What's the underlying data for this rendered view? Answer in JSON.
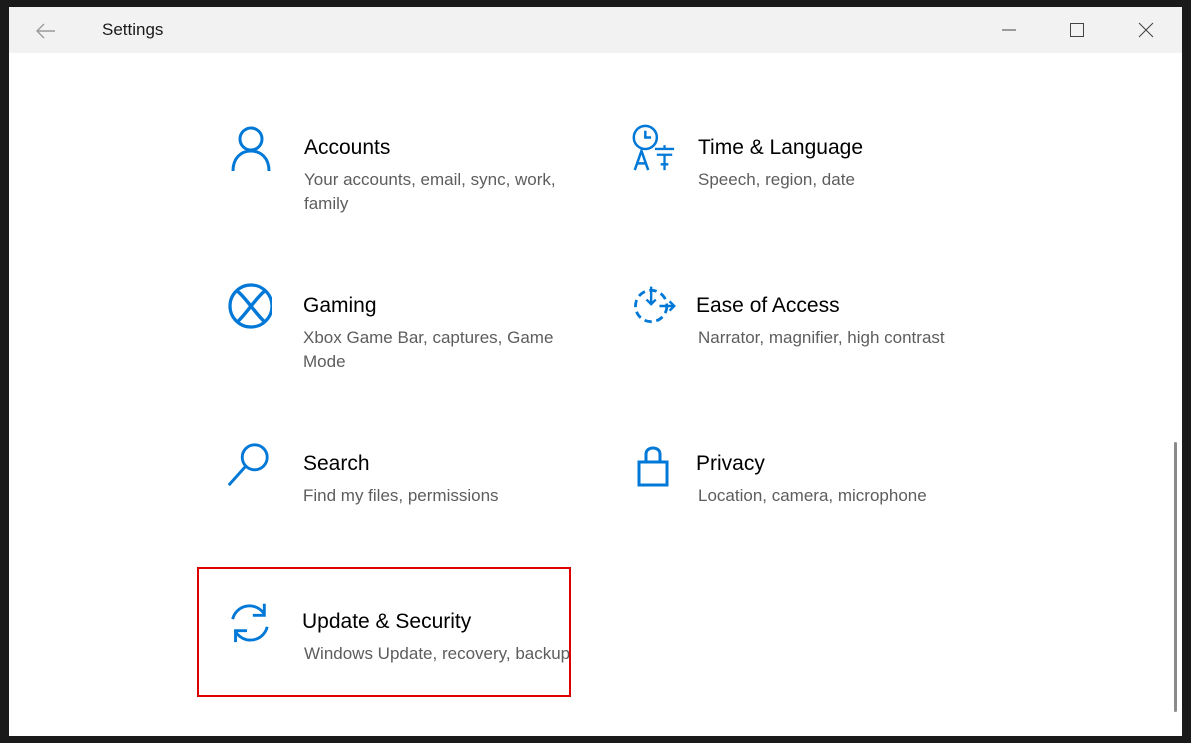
{
  "window": {
    "title": "Settings"
  },
  "colors": {
    "accent": "#0078d7",
    "highlight_border": "#e00000"
  },
  "tiles": [
    {
      "name": "Accounts",
      "desc": "Your accounts, email, sync, work, family",
      "icon": "person-icon"
    },
    {
      "name": "Time & Language",
      "desc": "Speech, region, date",
      "icon": "time-language-icon"
    },
    {
      "name": "Gaming",
      "desc": "Xbox Game Bar, captures, Game Mode",
      "icon": "xbox-icon"
    },
    {
      "name": "Ease of Access",
      "desc": "Narrator, magnifier, high contrast",
      "icon": "ease-of-access-icon"
    },
    {
      "name": "Search",
      "desc": "Find my files, permissions",
      "icon": "search-icon"
    },
    {
      "name": "Privacy",
      "desc": "Location, camera, microphone",
      "icon": "lock-icon"
    },
    {
      "name": "Update & Security",
      "desc": "Windows Update, recovery, backup",
      "icon": "sync-icon"
    }
  ]
}
